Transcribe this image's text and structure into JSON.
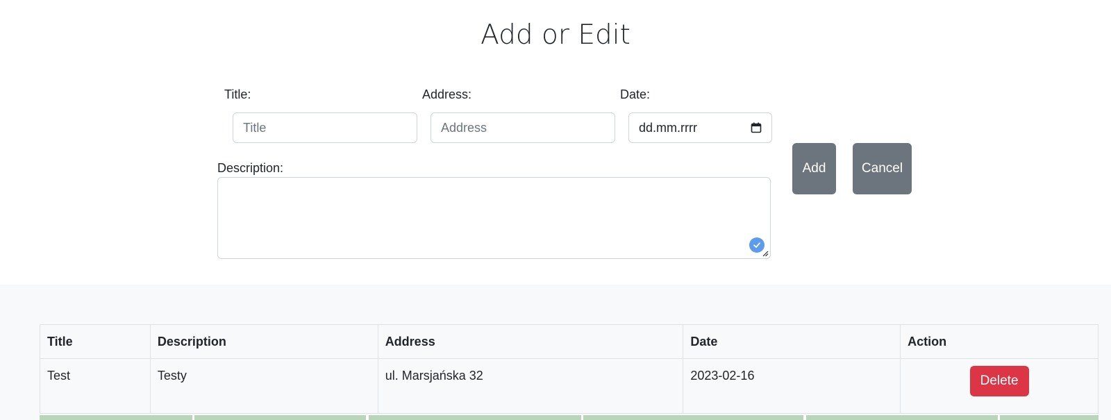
{
  "page": {
    "title": "Add or Edit"
  },
  "form": {
    "title_label": "Title:",
    "title_placeholder": "Title",
    "address_label": "Address:",
    "address_placeholder": "Address",
    "date_label": "Date:",
    "date_placeholder": "dd.mm.rrrr",
    "description_label": "Description:",
    "add_label": "Add",
    "cancel_label": "Cancel"
  },
  "table": {
    "headers": [
      "Title",
      "Description",
      "Address",
      "Date",
      "Action"
    ],
    "rows": [
      {
        "title": "Test",
        "description": "Testy",
        "address": "ul. Marsjańska 32",
        "date": "2023-02-16",
        "action": "Delete"
      }
    ]
  },
  "icons": {
    "date_picker": "calendar-icon",
    "grammar_check": "check-circle-icon",
    "resize": "resize-handle-icon"
  },
  "colors": {
    "secondary_button": "#6c757d",
    "danger_button": "#dc3545",
    "list_background": "#f8f9fa",
    "input_border": "#ced4da"
  }
}
